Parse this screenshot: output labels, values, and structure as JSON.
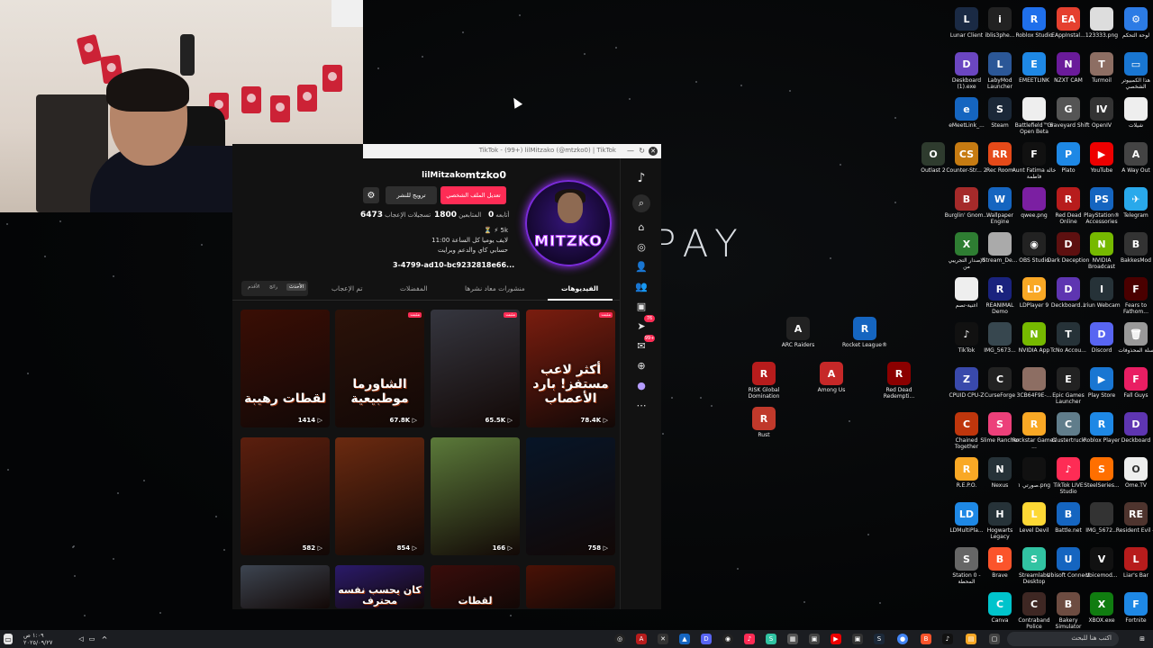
{
  "wallpaper": {
    "logo_text": "PAY"
  },
  "tiktok": {
    "window_title": "TikTok - (99+) lilMitzako (@mtzko0) | TikTok",
    "profile": {
      "username": "mtzko0",
      "display_name": "lilMitzako",
      "avatar_text": "MITZKO",
      "promote_button": "ترويج للنشر",
      "edit_button": "تعديل الملف الشخصي",
      "following_label": "أتابعه",
      "following_count": "0",
      "followers_label": "المتابعين",
      "followers_count": "1800",
      "likes_label": "تسجيلات الإعجاب",
      "likes_count": "6473",
      "bio_line1": "5k ⚡ ⏳",
      "bio_line2": "لايف يوميا كل الساعة 11:00",
      "bio_line3": "حسابي كاي والدعم وبرايت",
      "bio_link": "3-4799-ad10-bc9232818e66..."
    },
    "tabs": [
      {
        "label": "الفيديوهات"
      },
      {
        "label": "منشورات معاد نشرها"
      },
      {
        "label": "المفضلات"
      },
      {
        "label": "تم الإعجاب"
      }
    ],
    "sort_options": [
      {
        "label": "الأحدث"
      },
      {
        "label": "رائج"
      },
      {
        "label": "الأقدم"
      }
    ],
    "videos": [
      {
        "caption": "أكثر لاعب مستفز! بارد الأعصاب",
        "views": "78.4K",
        "pinned": "مثبت",
        "bg": "#7a1d0f"
      },
      {
        "caption": "",
        "views": "65.5K",
        "pinned": "مثبت",
        "bg": "#35363f"
      },
      {
        "caption": "الشاورما موطبيعية",
        "views": "67.8K",
        "pinned": "مثبت",
        "bg": "#2b1209"
      },
      {
        "caption": "لقطات رهيبة",
        "views": "1414",
        "pinned": "",
        "bg": "#3a0e05"
      },
      {
        "caption": "",
        "views": "758",
        "pinned": "",
        "bg": "#071527"
      },
      {
        "caption": "",
        "views": "166",
        "pinned": "",
        "bg": "#5b7a3a"
      },
      {
        "caption": "",
        "views": "854",
        "pinned": "",
        "bg": "#6b2a10"
      },
      {
        "caption": "",
        "views": "582",
        "pinned": "",
        "bg": "#5b1f0e"
      },
      {
        "caption": "",
        "views": "",
        "pinned": "",
        "bg": "#4a1206"
      },
      {
        "caption": "لقطات",
        "views": "",
        "pinned": "",
        "bg": "#3a0d0b"
      },
      {
        "caption": "كان يحسب نفسه محترف",
        "views": "",
        "pinned": "",
        "bg": "#2a1a6a"
      },
      {
        "caption": "",
        "views": "",
        "pinned": "",
        "bg": "#3d4551"
      }
    ]
  },
  "desktop_icons": [
    {
      "label": "Lunar Client",
      "color": "#1a2a44",
      "glyph": "L"
    },
    {
      "label": "iblis3phe...",
      "color": "#222",
      "glyph": "i"
    },
    {
      "label": "Roblox Studio",
      "color": "#1f6feb",
      "glyph": "R"
    },
    {
      "label": "EAppInstal...",
      "color": "#e5402f",
      "glyph": "EA"
    },
    {
      "label": "123333.png",
      "color": "#ddd",
      "glyph": ""
    },
    {
      "label": "لوحة التحكم",
      "color": "#2c7be5",
      "glyph": "⚙"
    },
    {
      "label": "Deskboard (1).exe",
      "color": "#6b46c1",
      "glyph": "D"
    },
    {
      "label": "LabyMod Launcher",
      "color": "#2b5797",
      "glyph": "L"
    },
    {
      "label": "EMEETLINK",
      "color": "#1e88e5",
      "glyph": "E"
    },
    {
      "label": "NZXT CAM",
      "color": "#6a1b9a",
      "glyph": "N"
    },
    {
      "label": "Turmoil",
      "color": "#8d6e63",
      "glyph": "T"
    },
    {
      "label": "هذا الكمبيوتر الشخصي",
      "color": "#1976d2",
      "glyph": "▭"
    },
    {
      "label": "eMeetLink_...",
      "color": "#1565c0",
      "glyph": "e"
    },
    {
      "label": "Steam",
      "color": "#1b2838",
      "glyph": "S"
    },
    {
      "label": "Battlefield™ 6 Open Beta",
      "color": "#eee",
      "glyph": ""
    },
    {
      "label": "Graveyard Shift",
      "color": "#555",
      "glyph": "G"
    },
    {
      "label": "OpenIV",
      "color": "#333",
      "glyph": "IV"
    },
    {
      "label": "شيلات",
      "color": "#eee",
      "glyph": ""
    },
    {
      "label": "Outlast 2",
      "color": "#2e3b2e",
      "glyph": "O"
    },
    {
      "label": "Counter-Str... 2",
      "color": "#c67b12",
      "glyph": "CS"
    },
    {
      "label": "Rec Room",
      "color": "#e64a19",
      "glyph": "RR"
    },
    {
      "label": "Aunt Fatima خالة فاطمة",
      "color": "#111",
      "glyph": "F"
    },
    {
      "label": "Plato",
      "color": "#1e88e5",
      "glyph": "P"
    },
    {
      "label": "YouTube",
      "color": "#e00",
      "glyph": "▶"
    },
    {
      "label": "A Way Out",
      "color": "#444",
      "glyph": "A"
    },
    {
      "label": "Burglin' Gnom...",
      "color": "#a52a2a",
      "glyph": "B"
    },
    {
      "label": "Wallpaper Engine",
      "color": "#1565c0",
      "glyph": "W"
    },
    {
      "label": "qwee.png",
      "color": "#7b1fa2",
      "glyph": ""
    },
    {
      "label": "Red Dead Online",
      "color": "#b71c1c",
      "glyph": "R"
    },
    {
      "label": "PlayStation® Accessories",
      "color": "#1565c0",
      "glyph": "PS"
    },
    {
      "label": "Telegram",
      "color": "#29a9eb",
      "glyph": "✈"
    },
    {
      "label": "الإصدار التجريبي من",
      "color": "#2e7d32",
      "glyph": "X"
    },
    {
      "label": "Stream_De...",
      "color": "#aaa",
      "glyph": ""
    },
    {
      "label": "OBS Studio",
      "color": "#222",
      "glyph": "◉"
    },
    {
      "label": "Dark Deception",
      "color": "#5d1010",
      "glyph": "D"
    },
    {
      "label": "NVIDIA Broadcast",
      "color": "#76b900",
      "glyph": "N"
    },
    {
      "label": "BakkesMod",
      "color": "#333",
      "glyph": "B"
    },
    {
      "label": "اغنية-تصم",
      "color": "#eee",
      "glyph": ""
    },
    {
      "label": "REANIMAL Demo",
      "color": "#1a237e",
      "glyph": "R"
    },
    {
      "label": "LDPlayer 9",
      "color": "#f9a825",
      "glyph": "LD"
    },
    {
      "label": "Deckboard...",
      "color": "#5e35b1",
      "glyph": "D"
    },
    {
      "label": "Iriun Webcam",
      "color": "#263238",
      "glyph": "I"
    },
    {
      "label": "Fears to Fathom...",
      "color": "#4a0000",
      "glyph": "F"
    },
    {
      "label": "TikTok",
      "color": "#111",
      "glyph": "♪"
    },
    {
      "label": "IMG_5673...",
      "color": "#37474f",
      "glyph": ""
    },
    {
      "label": "NVIDIA App",
      "color": "#76b900",
      "glyph": "N"
    },
    {
      "label": "TcNo Accou...",
      "color": "#263238",
      "glyph": "T"
    },
    {
      "label": "Discord",
      "color": "#5865f2",
      "glyph": "D"
    },
    {
      "label": "سلة المحذوفات",
      "color": "#999",
      "glyph": "🗑"
    },
    {
      "label": "CPUID CPU-Z",
      "color": "#3949ab",
      "glyph": "Z"
    },
    {
      "label": "CurseForge",
      "color": "#222",
      "glyph": "C"
    },
    {
      "label": "3CB64F9E-...",
      "color": "#8d6e63",
      "glyph": ""
    },
    {
      "label": "Epic Games Launcher",
      "color": "#222",
      "glyph": "E"
    },
    {
      "label": "Play Store",
      "color": "#1976d2",
      "glyph": "▶"
    },
    {
      "label": "Fall Guys",
      "color": "#e91e63",
      "glyph": "F"
    },
    {
      "label": "Chained Together",
      "color": "#bf360c",
      "glyph": "C"
    },
    {
      "label": "Slime Rancher",
      "color": "#ec407a",
      "glyph": "S"
    },
    {
      "label": "Rockstar Games ...",
      "color": "#f9a825",
      "glyph": "R"
    },
    {
      "label": "Clustertruck",
      "color": "#607d8b",
      "glyph": "C"
    },
    {
      "label": "Roblox Player",
      "color": "#1e88e5",
      "glyph": "R"
    },
    {
      "label": "Deckboard",
      "color": "#5e35b1",
      "glyph": "D"
    },
    {
      "label": "R.E.P.O.",
      "color": "#f9a825",
      "glyph": "R"
    },
    {
      "label": "Nexus",
      "color": "#263238",
      "glyph": "N"
    },
    {
      "label": "صورتي ١.png",
      "color": "#111",
      "glyph": ""
    },
    {
      "label": "TikTok LIVE Studio",
      "color": "#fe2c55",
      "glyph": "♪"
    },
    {
      "label": "SteelSeries...",
      "color": "#ff6f00",
      "glyph": "S"
    },
    {
      "label": "Ome.TV",
      "color": "#eee",
      "glyph": "O"
    },
    {
      "label": "LDMultiPla...",
      "color": "#1e88e5",
      "glyph": "LD"
    },
    {
      "label": "Hogwarts Legacy",
      "color": "#263238",
      "glyph": "H"
    },
    {
      "label": "Level Devil",
      "color": "#fdd835",
      "glyph": "L"
    },
    {
      "label": "Battle.net",
      "color": "#1565c0",
      "glyph": "B"
    },
    {
      "label": "IMG_5672...",
      "color": "#333",
      "glyph": ""
    },
    {
      "label": "Resident Evil 4",
      "color": "#4e342e",
      "glyph": "RE"
    },
    {
      "label": "Station 0 - المحطة",
      "color": "#666",
      "glyph": "S"
    },
    {
      "label": "Brave",
      "color": "#fb542b",
      "glyph": "B"
    },
    {
      "label": "Streamlabs Desktop",
      "color": "#31c3a2",
      "glyph": "S"
    },
    {
      "label": "Ubisoft Connect",
      "color": "#1565c0",
      "glyph": "U"
    },
    {
      "label": "Voicemod...",
      "color": "#111",
      "glyph": "V"
    },
    {
      "label": "Liar's Bar",
      "color": "#b71c1c",
      "glyph": "L"
    },
    {
      "label": "Canva",
      "color": "#00c4cc",
      "glyph": "C"
    },
    {
      "label": "Contraband Police",
      "color": "#3e2723",
      "glyph": "C"
    },
    {
      "label": "Bakery Simulator",
      "color": "#6d4c41",
      "glyph": "B"
    },
    {
      "label": "XBOX.exe",
      "color": "#107c10",
      "glyph": "X"
    },
    {
      "label": "Fortnite",
      "color": "#1e88e5",
      "glyph": "F"
    },
    {
      "label": "ARC Raiders",
      "color": "#222",
      "glyph": "A"
    },
    {
      "label": "Rocket League®",
      "color": "#1565c0",
      "glyph": "R"
    },
    {
      "label": "RISK Global Domination",
      "color": "#b71c1c",
      "glyph": "R"
    },
    {
      "label": "Among Us",
      "color": "#c62828",
      "glyph": "A"
    },
    {
      "label": "Red Dead Redempti...",
      "color": "#8b0000",
      "glyph": "R"
    },
    {
      "label": "Rust",
      "color": "#c0392b",
      "glyph": "R"
    }
  ],
  "taskbar": {
    "search_placeholder": "اكتب هنا للبحث",
    "clock_time": "١:٠٩ ص",
    "clock_date": "٢٠٢٥/٠٩/٢٧"
  }
}
